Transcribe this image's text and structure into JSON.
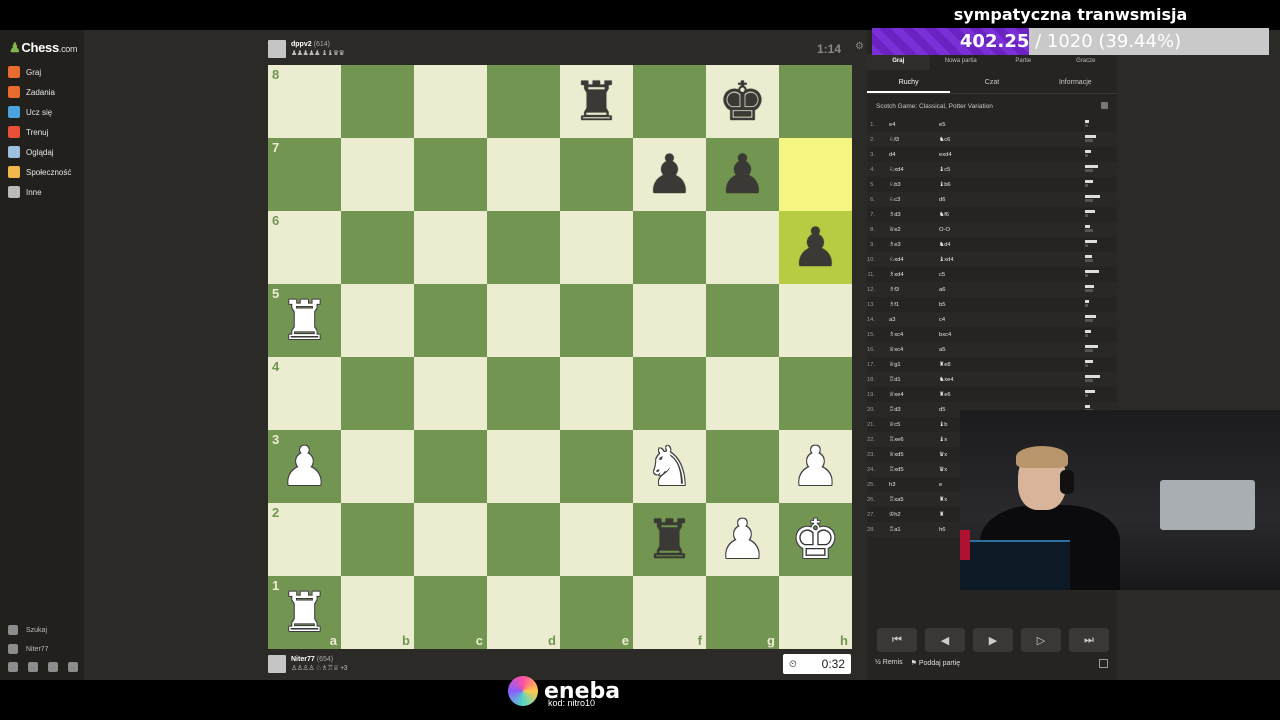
{
  "stream": {
    "title": "sympatyczna tranwsmisja",
    "progress_current": "402.25",
    "progress_rest": " / 1020 (39.44%)",
    "progress_fraction": 0.3944
  },
  "nav": {
    "logo": "Chess",
    "logo_domain": ".com",
    "items": [
      {
        "label": "Graj",
        "icon": "play-icon",
        "color": "#e86a2c"
      },
      {
        "label": "Zadania",
        "icon": "puzzle-icon",
        "color": "#e86a2c"
      },
      {
        "label": "Ucz się",
        "icon": "learn-icon",
        "color": "#4aa3df"
      },
      {
        "label": "Trenuj",
        "icon": "train-icon",
        "color": "#e8503a"
      },
      {
        "label": "Oglądaj",
        "icon": "watch-icon",
        "color": "#9cc0e0"
      },
      {
        "label": "Społeczność",
        "icon": "community-icon",
        "color": "#f0b84a"
      },
      {
        "label": "Inne",
        "icon": "more-icon",
        "color": "#bbbbbb"
      }
    ],
    "search_label": "Szukaj",
    "user_label": "Niter77",
    "badge_counts": [
      "54",
      "2"
    ]
  },
  "top_player": {
    "name": "dppv2",
    "rating": "(614)",
    "material": "♟♟♟♟♟ ♝♝♛♛",
    "clock": "1:14"
  },
  "bottom_player": {
    "name": "Niter77",
    "rating": "(654)",
    "material": "♙♙♙♙ ♘♗♖♕ +3",
    "clock": "0:32"
  },
  "board": {
    "ranks": [
      "8",
      "7",
      "6",
      "5",
      "4",
      "3",
      "2",
      "1"
    ],
    "files": [
      "a",
      "b",
      "c",
      "d",
      "e",
      "f",
      "g",
      "h"
    ],
    "position": [
      [
        "",
        "",
        "",
        "",
        "r",
        "",
        "k",
        ""
      ],
      [
        "",
        "",
        "",
        "",
        "",
        "p",
        "p",
        ""
      ],
      [
        "",
        "",
        "",
        "",
        "",
        "",
        "",
        "p"
      ],
      [
        "R",
        "",
        "",
        "",
        "",
        "",
        "",
        ""
      ],
      [
        "",
        "",
        "",
        "",
        "",
        "",
        "",
        ""
      ],
      [
        "P",
        "",
        "",
        "",
        "",
        "N",
        "",
        "P"
      ],
      [
        "",
        "",
        "",
        "",
        "",
        "r",
        "P",
        "K"
      ],
      [
        "R",
        "",
        "",
        "",
        "",
        "",
        "",
        ""
      ]
    ],
    "highlight": [
      "h7",
      "h6"
    ]
  },
  "panel": {
    "tabs": [
      "Graj",
      "Nowa partia",
      "Partie",
      "Gracze"
    ],
    "subtabs": [
      "Ruchy",
      "Czat",
      "Informacje"
    ],
    "opening": "Scotch Game: Classical, Potter Variation",
    "moves": [
      {
        "n": "1.",
        "w": "e4",
        "b": "e5"
      },
      {
        "n": "2.",
        "w": "♘f3",
        "b": "♞c6"
      },
      {
        "n": "3.",
        "w": "d4",
        "b": "exd4"
      },
      {
        "n": "4.",
        "w": "♘xd4",
        "b": "♝c5"
      },
      {
        "n": "5.",
        "w": "♘b3",
        "b": "♝b6"
      },
      {
        "n": "6.",
        "w": "♘c3",
        "b": "d6"
      },
      {
        "n": "7.",
        "w": "♗d3",
        "b": "♞f6"
      },
      {
        "n": "8.",
        "w": "♕e2",
        "b": "O-O"
      },
      {
        "n": "9.",
        "w": "♗e3",
        "b": "♞d4"
      },
      {
        "n": "10.",
        "w": "♘xd4",
        "b": "♝xd4"
      },
      {
        "n": "11.",
        "w": "♗xd4",
        "b": "c5"
      },
      {
        "n": "12.",
        "w": "♗f3",
        "b": "a6"
      },
      {
        "n": "13.",
        "w": "♗f1",
        "b": "b5"
      },
      {
        "n": "14.",
        "w": "a3",
        "b": "c4"
      },
      {
        "n": "15.",
        "w": "♗xc4",
        "b": "bxc4"
      },
      {
        "n": "16.",
        "w": "♕xc4",
        "b": "a5"
      },
      {
        "n": "17.",
        "w": "♕g1",
        "b": "♜e8"
      },
      {
        "n": "18.",
        "w": "♖d1",
        "b": "♞xe4"
      },
      {
        "n": "19.",
        "w": "♕xe4",
        "b": "♜e6"
      },
      {
        "n": "20.",
        "w": "♖d3",
        "b": "d5"
      },
      {
        "n": "21.",
        "w": "♕c5",
        "b": "♝b"
      },
      {
        "n": "22.",
        "w": "♖xe6",
        "b": "♝x"
      },
      {
        "n": "23.",
        "w": "♕xd5",
        "b": "♛x"
      },
      {
        "n": "24.",
        "w": "♖xd5",
        "b": "♛x"
      },
      {
        "n": "25.",
        "w": "h3",
        "b": "e"
      },
      {
        "n": "26.",
        "w": "♖xa5",
        "b": "♜x"
      },
      {
        "n": "27.",
        "w": "♔h2",
        "b": "♜"
      },
      {
        "n": "28.",
        "w": "♖a1",
        "b": "h6"
      }
    ],
    "nav_buttons": [
      "⏮",
      "◀",
      "▶",
      "▷",
      "⏭"
    ],
    "draw_label": "Remis",
    "resign_label": "Poddaj partię",
    "draw_prefix": "½"
  },
  "sponsor": {
    "name": "eneba",
    "code": "kod: nitro10"
  }
}
